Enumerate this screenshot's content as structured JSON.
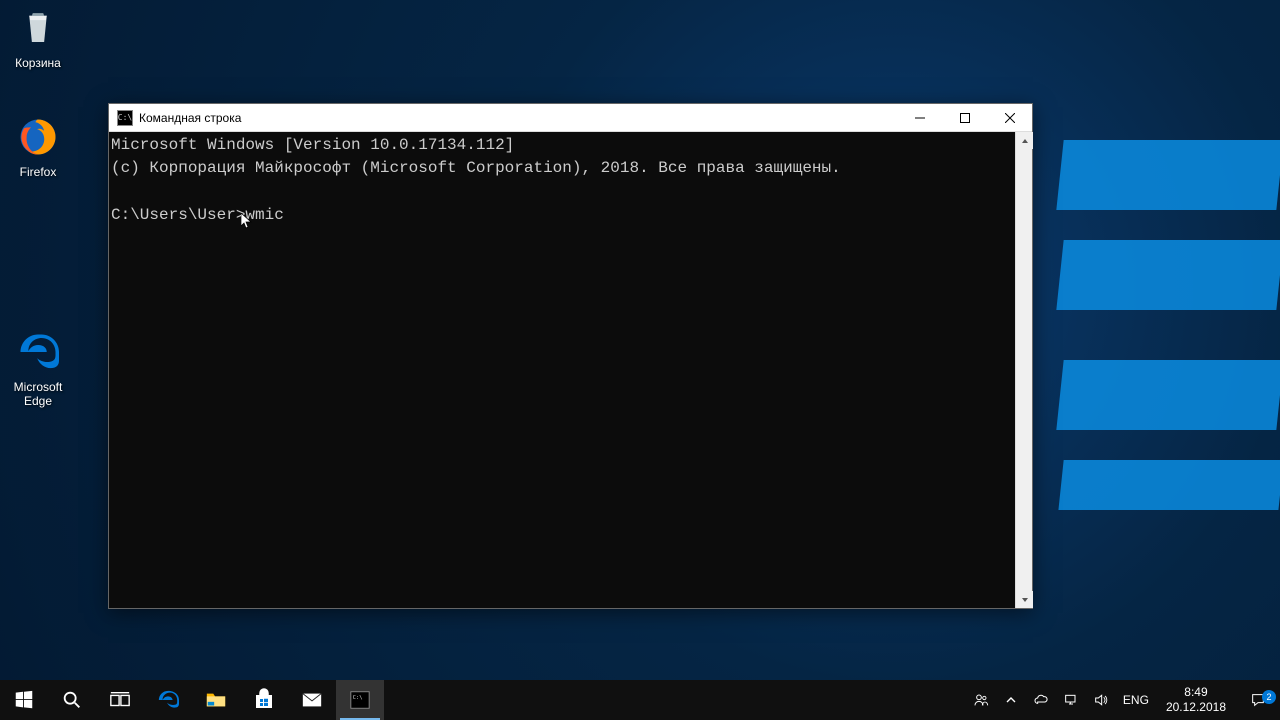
{
  "desktop": {
    "icons": {
      "recycle_bin": "Корзина",
      "firefox": "Firefox",
      "edge": "Microsoft Edge"
    }
  },
  "window": {
    "title": "Командная строка",
    "lines": {
      "l1": "Microsoft Windows [Version 10.0.17134.112]",
      "l2": "(c) Корпорация Майкрософт (Microsoft Corporation), 2018. Все права защищены.",
      "blank": "",
      "prompt": "C:\\Users\\User>",
      "command": "wmic"
    }
  },
  "taskbar": {
    "language": "ENG",
    "time": "8:49",
    "date": "20.12.2018",
    "notifications": "2"
  }
}
